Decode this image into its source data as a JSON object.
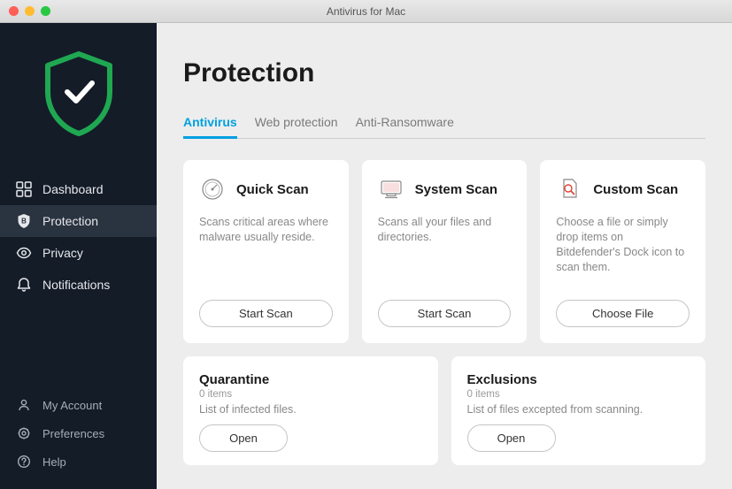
{
  "window": {
    "title": "Antivirus for Mac"
  },
  "sidebar": {
    "nav": [
      {
        "icon": "dashboard-icon",
        "label": "Dashboard"
      },
      {
        "icon": "shield-icon",
        "label": "Protection",
        "active": true
      },
      {
        "icon": "eye-icon",
        "label": "Privacy"
      },
      {
        "icon": "bell-icon",
        "label": "Notifications"
      }
    ],
    "footer": [
      {
        "icon": "user-icon",
        "label": "My Account"
      },
      {
        "icon": "gear-icon",
        "label": "Preferences"
      },
      {
        "icon": "help-icon",
        "label": "Help"
      }
    ]
  },
  "page": {
    "title": "Protection",
    "tabs": [
      {
        "label": "Antivirus",
        "active": true
      },
      {
        "label": "Web protection"
      },
      {
        "label": "Anti-Ransomware"
      }
    ]
  },
  "scan_cards": [
    {
      "title": "Quick Scan",
      "description": "Scans critical areas where malware usually reside.",
      "button": "Start Scan"
    },
    {
      "title": "System Scan",
      "description": "Scans all your files and directories.",
      "button": "Start Scan"
    },
    {
      "title": "Custom Scan",
      "description": "Choose a file or simply drop items on Bitdefender's Dock icon to scan them.",
      "button": "Choose File"
    }
  ],
  "bottom_cards": [
    {
      "title": "Quarantine",
      "count": "0 items",
      "description": "List of infected files.",
      "button": "Open"
    },
    {
      "title": "Exclusions",
      "count": "0 items",
      "description": "List of files excepted from scanning.",
      "button": "Open"
    }
  ]
}
